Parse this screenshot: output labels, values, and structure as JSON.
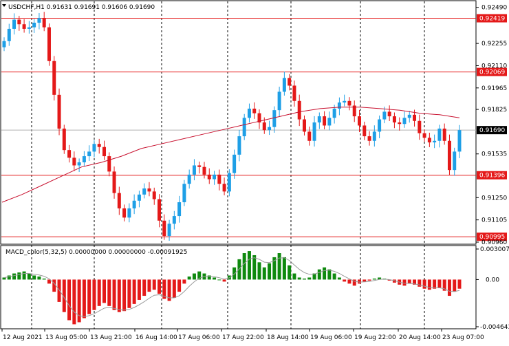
{
  "chart_header": {
    "title": "USDCHF,H1  0.91631 0.91691 0.91606 0.91690",
    "dropdown_arrow": "triangle-down-icon"
  },
  "macd_header": {
    "title": "MACD_color(5,32,5) 0.00000000 0.00000000 -0.00091925"
  },
  "colors": {
    "bull": "#1e9fe6",
    "bear": "#e41919",
    "level_line": "#e41919",
    "ma_line": "#c8102e",
    "macd_pos": "#0f8a0f",
    "macd_neg": "#e41919",
    "signal_line": "#9a9a9a",
    "grid": "#000000",
    "label_bg": "#e41919",
    "current_bg": "#000000"
  },
  "price_axis": {
    "ticks": [
      "0.92490",
      "0.92255",
      "0.92110",
      "0.91965",
      "0.91825",
      "0.91535",
      "0.91250",
      "0.91105",
      "0.90960"
    ]
  },
  "level_labels": [
    "0.92419",
    "0.92069",
    "0.91396",
    "0.90995"
  ],
  "current_price_label": "0.91690",
  "macd_axis": {
    "ticks": [
      "0.0030073",
      "0.00",
      "-0.004643"
    ]
  },
  "time_axis": {
    "labels": [
      "12 Aug 2021",
      "13 Aug 05:00",
      "13 Aug 21:00",
      "16 Aug 14:00",
      "17 Aug 06:00",
      "17 Aug 22:00",
      "18 Aug 14:00",
      "19 Aug 06:00",
      "19 Aug 22:00",
      "20 Aug 14:00",
      "23 Aug 07:00"
    ]
  },
  "chart_data": {
    "type": "candlestick",
    "symbol": "USDCHF",
    "timeframe": "H1",
    "ohlc_header": {
      "open": 0.91631,
      "high": 0.91691,
      "low": 0.91606,
      "close": 0.9169
    },
    "y_range": [
      0.9096,
      0.9252
    ],
    "horizontal_levels": [
      0.92419,
      0.92069,
      0.91396,
      0.90995
    ],
    "current_price": 0.9169,
    "close_path": [
      0.9227,
      0.9235,
      0.9241,
      0.9238,
      0.9235,
      0.9236,
      0.9239,
      0.9242,
      0.9236,
      0.9214,
      0.9192,
      0.917,
      0.9156,
      0.9151,
      0.9146,
      0.9148,
      0.9152,
      0.9155,
      0.916,
      0.9158,
      0.9152,
      0.9142,
      0.9128,
      0.9118,
      0.9112,
      0.9118,
      0.9123,
      0.9127,
      0.9131,
      0.9129,
      0.9124,
      0.911,
      0.91,
      0.9108,
      0.9113,
      0.9122,
      0.9134,
      0.914,
      0.9146,
      0.9145,
      0.914,
      0.9137,
      0.914,
      0.9134,
      0.9129,
      0.9141,
      0.9153,
      0.9165,
      0.9177,
      0.9183,
      0.918,
      0.9174,
      0.9169,
      0.9171,
      0.9182,
      0.9194,
      0.9203,
      0.9198,
      0.9188,
      0.9176,
      0.9168,
      0.9162,
      0.9174,
      0.9178,
      0.9172,
      0.9177,
      0.9183,
      0.9187,
      0.9188,
      0.9185,
      0.9178,
      0.9172,
      0.9165,
      0.9162,
      0.9168,
      0.9176,
      0.9181,
      0.9178,
      0.9174,
      0.9173,
      0.9177,
      0.9179,
      0.9175,
      0.9167,
      0.9164,
      0.9161,
      0.9162,
      0.917,
      0.9162,
      0.9143,
      0.9155,
      0.9169
    ],
    "ma_path": [
      0.9122,
      0.9127,
      0.9133,
      0.9139,
      0.9145,
      0.9148,
      0.9152,
      0.9157,
      0.916,
      0.9163,
      0.9166,
      0.9169,
      0.9172,
      0.9175,
      0.9178,
      0.9181,
      0.9183,
      0.9184,
      0.9184,
      0.9183,
      0.9182,
      0.918,
      0.9179,
      0.9177
    ],
    "macd_range": [
      -0.004643,
      0.0030073
    ],
    "macd_values": [
      0.0002,
      0.0004,
      0.0006,
      0.0007,
      0.0008,
      0.0006,
      0.0004,
      0.0003,
      0.0001,
      -0.0004,
      -0.0012,
      -0.0022,
      -0.0032,
      -0.004,
      -0.0044,
      -0.0042,
      -0.0038,
      -0.0034,
      -0.003,
      -0.0026,
      -0.0023,
      -0.0026,
      -0.003,
      -0.0032,
      -0.0031,
      -0.0028,
      -0.0024,
      -0.002,
      -0.0016,
      -0.0012,
      -0.001,
      -0.0014,
      -0.0019,
      -0.0021,
      -0.0018,
      -0.0012,
      -0.0004,
      0.0003,
      0.0006,
      0.0008,
      0.0006,
      0.0004,
      0.0002,
      0.0,
      -0.0002,
      0.0004,
      0.0012,
      0.002,
      0.0026,
      0.0028,
      0.0024,
      0.0017,
      0.0012,
      0.0016,
      0.0022,
      0.0026,
      0.0022,
      0.0014,
      0.0006,
      0.0002,
      0.0001,
      0.0002,
      0.0006,
      0.001,
      0.0012,
      0.001,
      0.0006,
      0.0002,
      -0.0002,
      -0.0004,
      -0.0006,
      -0.0004,
      -0.0002,
      -0.0001,
      0.0001,
      0.0002,
      0.0001,
      -0.0001,
      -0.0003,
      -0.0005,
      -0.0006,
      -0.0004,
      -0.0005,
      -0.0007,
      -0.0009,
      -0.001,
      -0.0009,
      -0.0008,
      -0.0011,
      -0.0016,
      -0.0012,
      -0.0009
    ]
  }
}
